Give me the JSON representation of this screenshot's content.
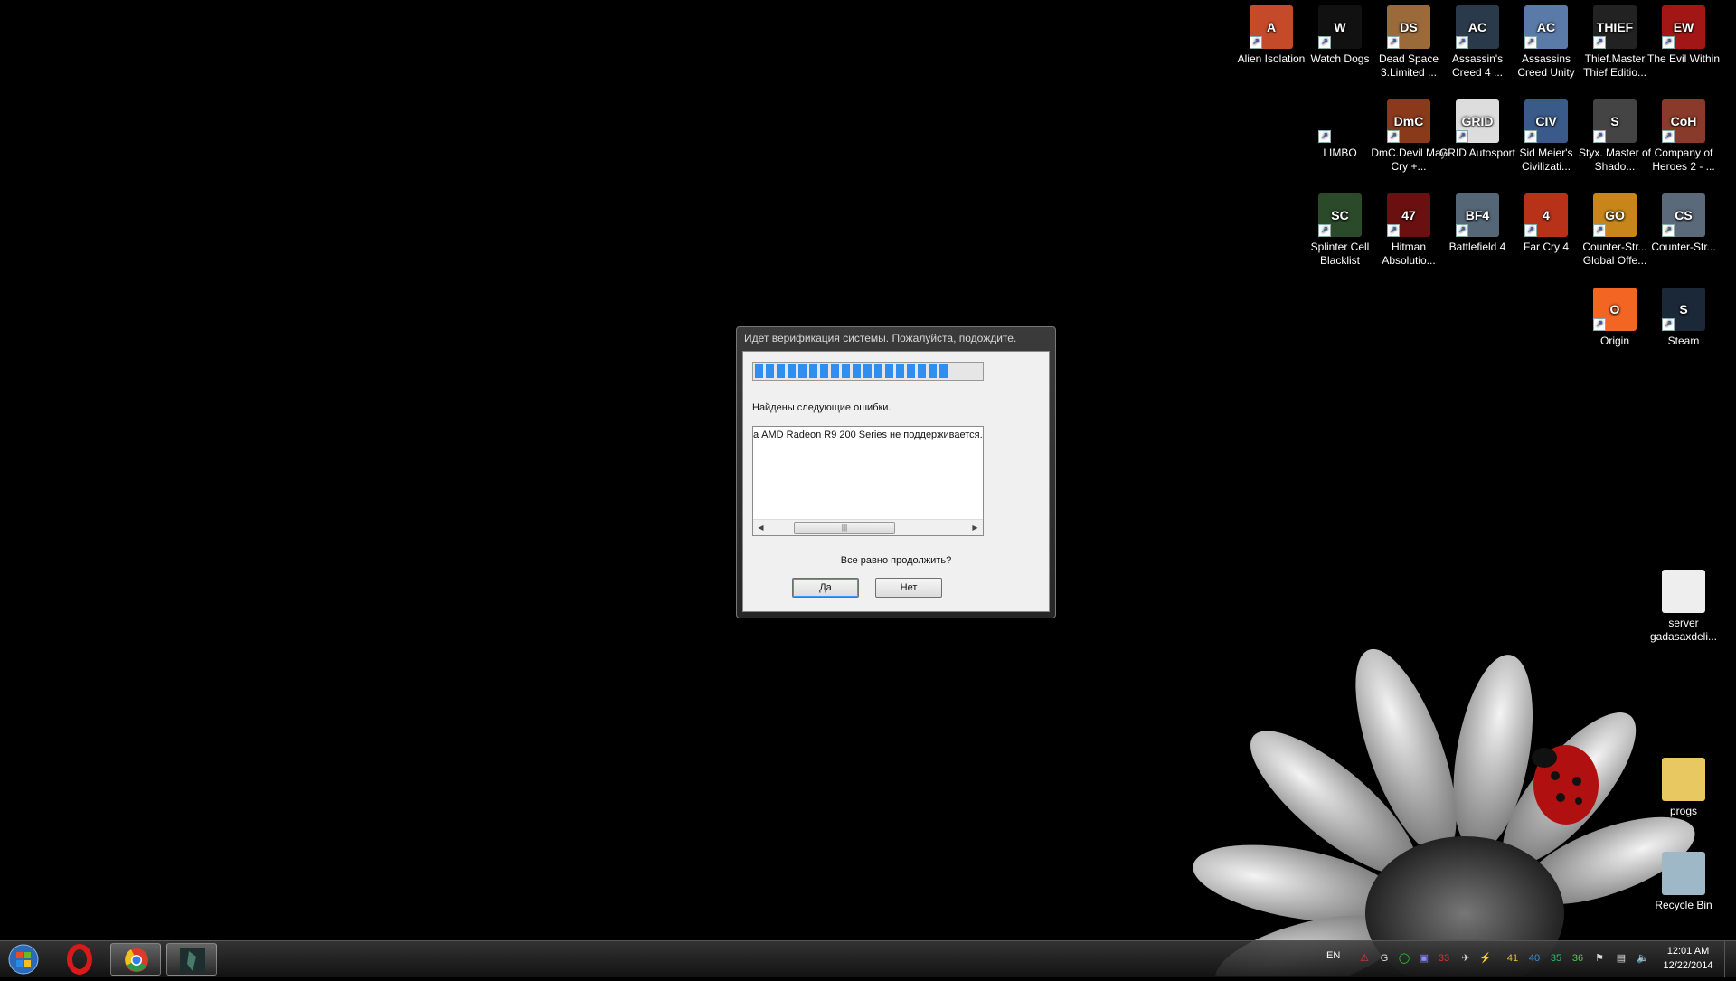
{
  "desktop": {
    "icons": [
      {
        "id": "alien",
        "label": "Alien Isolation",
        "color": "#c44a2a",
        "glyph": "A"
      },
      {
        "id": "watchdogs",
        "label": "Watch Dogs",
        "color": "#111111",
        "glyph": "W"
      },
      {
        "id": "deadspace",
        "label": "Dead Space 3.Limited ...",
        "color": "#9b6a3b",
        "glyph": "DS"
      },
      {
        "id": "ac4",
        "label": "Assassin's Creed 4 ...",
        "color": "#2a3a4a",
        "glyph": "AC"
      },
      {
        "id": "acunity",
        "label": "Assassins Creed Unity",
        "color": "#5a7aa8",
        "glyph": "AC"
      },
      {
        "id": "thief",
        "label": "Thief.Master Thief Editio...",
        "color": "#222222",
        "glyph": "THIEF"
      },
      {
        "id": "evilwithin",
        "label": "The Evil Within",
        "color": "#a21616",
        "glyph": "EW"
      },
      {
        "id": "limbo",
        "label": "LIMBO",
        "color": "#000000",
        "glyph": ""
      },
      {
        "id": "dmc",
        "label": "DmC.Devil May Cry +...",
        "color": "#8a3a1a",
        "glyph": "DmC"
      },
      {
        "id": "grid",
        "label": "GRID Autosport",
        "color": "#dddddd",
        "glyph": "GRID"
      },
      {
        "id": "civ",
        "label": "Sid Meier's Civilizati...",
        "color": "#3a5a8a",
        "glyph": "CIV"
      },
      {
        "id": "styx",
        "label": "Styx. Master of Shado...",
        "color": "#444444",
        "glyph": "S"
      },
      {
        "id": "coh2",
        "label": "Company of Heroes 2 - ...",
        "color": "#8a3a2a",
        "glyph": "CoH"
      },
      {
        "id": "splinter",
        "label": "Splinter Cell Blacklist",
        "color": "#2a4a2a",
        "glyph": "SC"
      },
      {
        "id": "hitman",
        "label": "Hitman Absolutio...",
        "color": "#6a1010",
        "glyph": "47"
      },
      {
        "id": "bf4",
        "label": "Battlefield 4",
        "color": "#556677",
        "glyph": "BF4"
      },
      {
        "id": "farcry4",
        "label": "Far Cry 4",
        "color": "#b8321a",
        "glyph": "4"
      },
      {
        "id": "csgo",
        "label": "Counter-Str... Global Offe...",
        "color": "#c8861a",
        "glyph": "GO"
      },
      {
        "id": "cs",
        "label": "Counter-Str...",
        "color": "#5a6a7a",
        "glyph": "CS"
      },
      {
        "id": "origin",
        "label": "Origin",
        "color": "#f26522",
        "glyph": "O"
      },
      {
        "id": "steam",
        "label": "Steam",
        "color": "#1b2838",
        "glyph": "S"
      },
      {
        "id": "server",
        "label": "server gadasaxdeli...",
        "color": "#eeeeee",
        "glyph": ""
      },
      {
        "id": "progs",
        "label": "progs",
        "color": "#e8c860",
        "glyph": ""
      },
      {
        "id": "recycle",
        "label": "Recycle Bin",
        "color": "#9fb8c8",
        "glyph": ""
      }
    ]
  },
  "dialog": {
    "title": "Идет верификация системы. Пожалуйста, подождите.",
    "progress_segments": 18,
    "errors_label": "Найдены следующие ошибки.",
    "error_text": "а AMD Radeon R9 200 Series не поддерживается.",
    "scroll_thumb": "|||",
    "question": "Все равно продолжить?",
    "yes_label": "Да",
    "no_label": "Нет"
  },
  "taskbar": {
    "apps": [
      {
        "id": "opera",
        "color": "#cc1111"
      },
      {
        "id": "chrome",
        "color": "#4a8a3a"
      },
      {
        "id": "game",
        "color": "#2a3a3a"
      }
    ],
    "language": "EN",
    "tray_numbers": [
      {
        "text": "33",
        "color": "#e03030"
      },
      {
        "text": "41",
        "color": "#e0c020"
      },
      {
        "text": "40",
        "color": "#3090e0"
      },
      {
        "text": "35",
        "color": "#30c070"
      },
      {
        "text": "36",
        "color": "#50d040"
      }
    ],
    "time": "12:01 AM",
    "date": "12/22/2014"
  }
}
